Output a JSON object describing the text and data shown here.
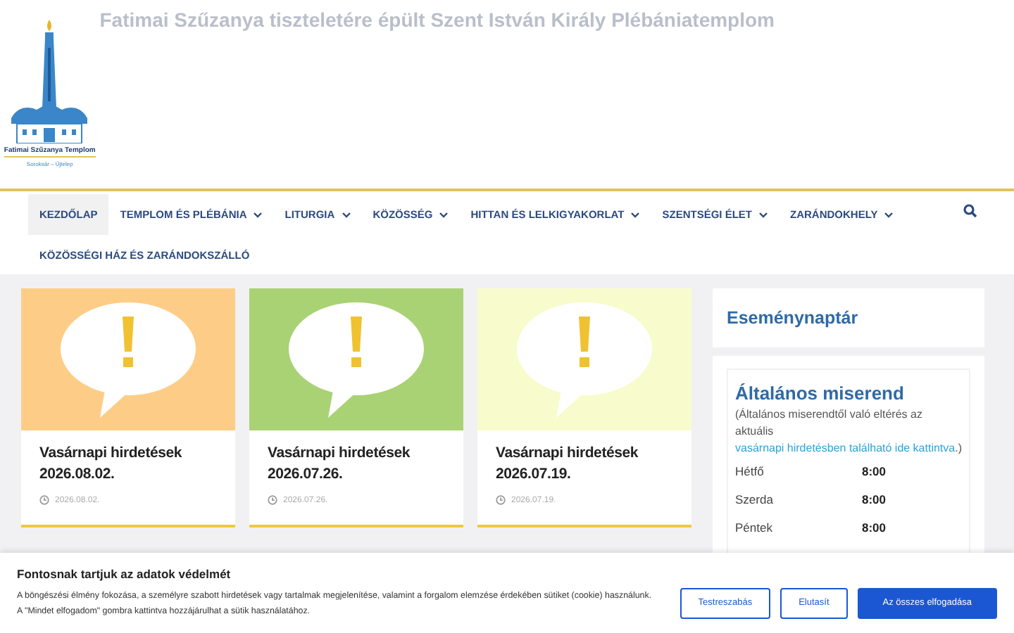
{
  "site": {
    "tagline": "Fatimai Szűzanya tiszteletére épült Szent István Király Plébániatemplom",
    "logo_name": "Fatimai Szűzanya Templom",
    "logo_place": "Soroksár – Újtelep"
  },
  "nav": {
    "items": [
      {
        "label": "KEZDŐLAP",
        "selected": true,
        "dropdown": false
      },
      {
        "label": "TEMPLOM ÉS PLÉBÁNIA",
        "selected": false,
        "dropdown": true
      },
      {
        "label": "LITURGIA",
        "selected": false,
        "dropdown": true
      },
      {
        "label": "KÖZÖSSÉG",
        "selected": false,
        "dropdown": true
      },
      {
        "label": "HITTAN ÉS LELKIGYAKORLAT",
        "selected": false,
        "dropdown": true
      },
      {
        "label": "SZENTSÉGI ÉLET",
        "selected": false,
        "dropdown": true
      },
      {
        "label": "ZARÁNDOKHELY",
        "selected": false,
        "dropdown": true
      },
      {
        "label": "KÖZÖSSÉGI HÁZ ÉS ZARÁNDOKSZÁLLÓ",
        "selected": false,
        "dropdown": false
      }
    ]
  },
  "posts": [
    {
      "title": "Vasárnapi hirdetések 2026.08.02.",
      "date": "2026.08.02.",
      "color": "#fdcd88"
    },
    {
      "title": "Vasárnapi hirdetések 2026.07.26.",
      "date": "2026.07.26.",
      "color": "#a9d274"
    },
    {
      "title": "Vasárnapi hirdetések 2026.07.19.",
      "date": "2026.07.19.",
      "color": "#f8fccd"
    }
  ],
  "sidebar": {
    "calendar_title": "Eseménynaptár",
    "mass": {
      "title": "Általános miserend",
      "note_before": "(Általános miserendtől való eltérés az aktuális ",
      "note_link": "vasárnapi hirdetésben található ide kattintva",
      "note_after": ".)",
      "rows": [
        {
          "day": "Hétfő",
          "time": "8:00"
        },
        {
          "day": "Szerda",
          "time": "8:00"
        },
        {
          "day": "Péntek",
          "time": "8:00"
        }
      ]
    }
  },
  "cookie": {
    "title": "Fontosnak tartjuk az adatok védelmét",
    "text": "A böngészési élmény fokozása, a személyre szabott hirdetések vagy tartalmak megjelenítése, valamint a forgalom elemzése érdekében sütiket (cookie) használunk. A \"Mindet elfogadom\" gombra kattintva hozzájárulhat a sütik használatához.",
    "buttons": [
      {
        "label": "Testreszabás",
        "kind": "outline"
      },
      {
        "label": "Elutasít",
        "kind": "outline"
      },
      {
        "label": "Az összes elfogadása",
        "kind": "primary"
      }
    ]
  }
}
